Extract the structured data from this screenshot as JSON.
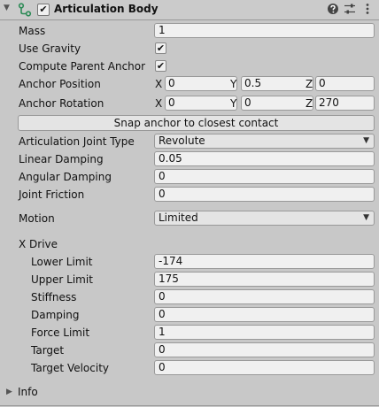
{
  "header": {
    "title": "Articulation Body",
    "enabled_check": "✔"
  },
  "fields": {
    "mass": {
      "label": "Mass",
      "value": "1"
    },
    "use_gravity": {
      "label": "Use Gravity",
      "check": "✔"
    },
    "compute_parent_anchor": {
      "label": "Compute Parent Anchor",
      "check": "✔"
    },
    "anchor_position": {
      "label": "Anchor Position",
      "x_label": "X",
      "y_label": "Y",
      "z_label": "Z",
      "x": "0",
      "y": "0.5",
      "z": "0"
    },
    "anchor_rotation": {
      "label": "Anchor Rotation",
      "x_label": "X",
      "y_label": "Y",
      "z_label": "Z",
      "x": "0",
      "y": "0",
      "z": "270"
    },
    "snap_button": "Snap anchor to closest contact",
    "joint_type": {
      "label": "Articulation Joint Type",
      "value": "Revolute"
    },
    "linear_damping": {
      "label": "Linear Damping",
      "value": "0.05"
    },
    "angular_damping": {
      "label": "Angular Damping",
      "value": "0"
    },
    "joint_friction": {
      "label": "Joint Friction",
      "value": "0"
    },
    "motion": {
      "label": "Motion",
      "value": "Limited"
    }
  },
  "x_drive": {
    "section_label": "X Drive",
    "lower_limit": {
      "label": "Lower Limit",
      "value": "-174"
    },
    "upper_limit": {
      "label": "Upper Limit",
      "value": "175"
    },
    "stiffness": {
      "label": "Stiffness",
      "value": "0"
    },
    "damping": {
      "label": "Damping",
      "value": "0"
    },
    "force_limit": {
      "label": "Force Limit",
      "value": "1"
    },
    "target": {
      "label": "Target",
      "value": "0"
    },
    "target_velocity": {
      "label": "Target Velocity",
      "value": "0"
    }
  },
  "info": {
    "label": "Info"
  },
  "icons": {
    "foldout_open": "▼",
    "foldout_closed": "▶",
    "dropdown_arrow": "▼",
    "component": "articulation-icon",
    "help": "help-icon",
    "presets": "presets-icon",
    "menu": "kebab-menu-icon"
  },
  "colors": {
    "background": "#c8c8c8",
    "field": "#f0f0f0",
    "component_icon": "#2e8b57"
  }
}
